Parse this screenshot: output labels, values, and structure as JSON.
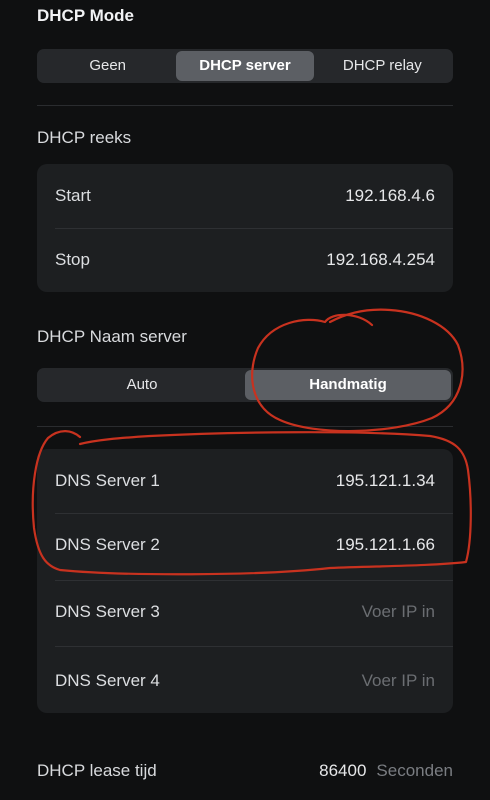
{
  "dhcp_mode": {
    "title": "DHCP Mode",
    "options": [
      "Geen",
      "DHCP server",
      "DHCP relay"
    ],
    "selected": "DHCP server"
  },
  "dhcp_range": {
    "title": "DHCP reeks",
    "start_label": "Start",
    "start_value": "192.168.4.6",
    "stop_label": "Stop",
    "stop_value": "192.168.4.254"
  },
  "name_server": {
    "title": "DHCP Naam server",
    "options": [
      "Auto",
      "Handmatig"
    ],
    "selected": "Handmatig"
  },
  "dns": [
    {
      "label": "DNS Server 1",
      "value": "195.121.1.34",
      "placeholder": ""
    },
    {
      "label": "DNS Server 2",
      "value": "195.121.1.66",
      "placeholder": ""
    },
    {
      "label": "DNS Server 3",
      "value": "",
      "placeholder": "Voer IP in"
    },
    {
      "label": "DNS Server 4",
      "value": "",
      "placeholder": "Voer IP in"
    }
  ],
  "lease": {
    "label": "DHCP lease tijd",
    "value": "86400",
    "unit": "Seconden"
  },
  "colors": {
    "background": "#0f1011",
    "card": "#1d1f21",
    "segment_active": "#5c5f64",
    "annotation": "#c8321f"
  }
}
